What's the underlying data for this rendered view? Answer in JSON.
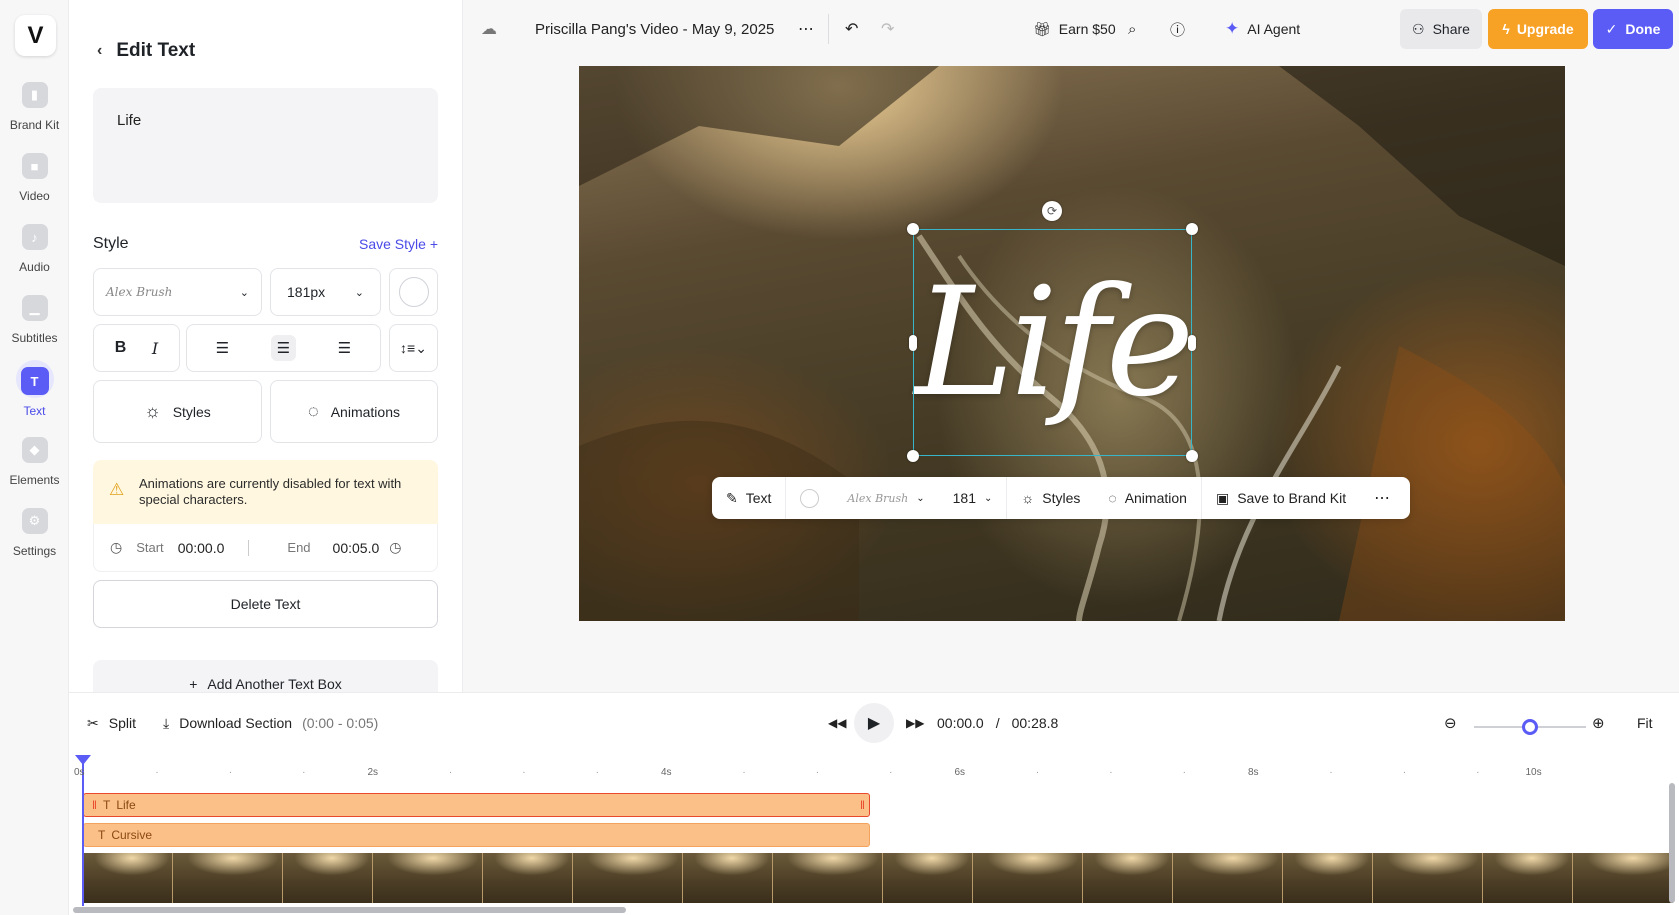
{
  "rail": {
    "logo": "V",
    "items": [
      {
        "label": "Brand Kit"
      },
      {
        "label": "Video"
      },
      {
        "label": "Audio"
      },
      {
        "label": "Subtitles"
      },
      {
        "label": "Text"
      },
      {
        "label": "Elements"
      },
      {
        "label": "Settings"
      }
    ],
    "active": "Text"
  },
  "panel": {
    "title": "Edit Text",
    "text_value": "Life",
    "style_label": "Style",
    "save_style": "Save Style +",
    "font_name": "Alex Brush",
    "font_size": "181px",
    "styles_label": "Styles",
    "animations_label": "Animations",
    "warning": "Animations are currently disabled for text with special characters.",
    "start_label": "Start",
    "start_value": "00:00.0",
    "end_label": "End",
    "end_value": "00:05.0",
    "delete_label": "Delete Text",
    "add_label": "Add Another Text Box"
  },
  "topbar": {
    "title": "Priscilla Pang's Video - May 9, 2025",
    "earn": "Earn $50",
    "ai_agent": "AI Agent",
    "share": "Share",
    "upgrade": "Upgrade",
    "done": "Done"
  },
  "canvas": {
    "overlay_text": "Life",
    "ctx": {
      "text": "Text",
      "font": "Alex Brush",
      "size": "181",
      "styles": "Styles",
      "animation": "Animation",
      "brand": "Save to Brand Kit"
    }
  },
  "timeline": {
    "split": "Split",
    "download": "Download Section",
    "download_range": "(0:00 - 0:05)",
    "current_time": "00:00.0",
    "separator": "/",
    "duration": "00:28.8",
    "fit": "Fit",
    "ticks": [
      "0s",
      "2s",
      "4s",
      "6s",
      "8s",
      "10s"
    ],
    "clips": [
      {
        "label": "Life"
      },
      {
        "label": "Cursive"
      }
    ],
    "zoom_level": 0.5
  },
  "colors": {
    "accent": "#5b5bf6",
    "upgrade": "#f7a125",
    "clip": "#fbbf88",
    "clip_border": "#e8482b"
  }
}
